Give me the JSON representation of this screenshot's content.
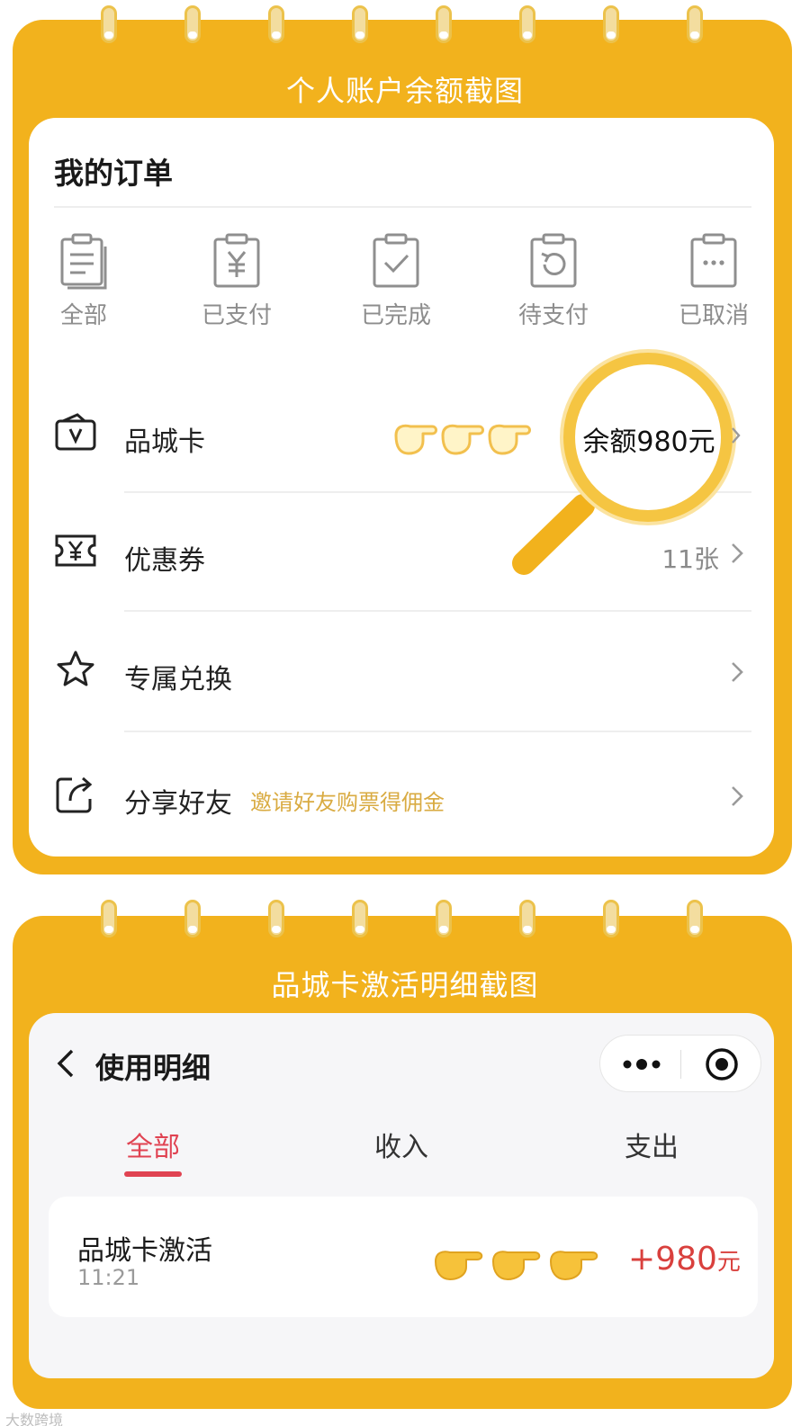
{
  "colors": {
    "frame": "#f2b21d",
    "accent_red": "#e04352",
    "hint_gold": "#d9ab42",
    "amount_red": "#d9403d"
  },
  "section1": {
    "banner_title": "个人账户余额截图",
    "header": "我的订单",
    "order_tabs": [
      {
        "label": "全部",
        "icon": "list-clipboard-icon"
      },
      {
        "label": "已支付",
        "icon": "yen-clipboard-icon"
      },
      {
        "label": "已完成",
        "icon": "check-clipboard-icon"
      },
      {
        "label": "待支付",
        "icon": "refresh-clipboard-icon"
      },
      {
        "label": "已取消",
        "icon": "dots-clipboard-icon"
      }
    ],
    "rows": [
      {
        "label": "品城卡",
        "icon": "v-card-icon",
        "value": ""
      },
      {
        "label": "优惠券",
        "icon": "yen-coupon-icon",
        "value": "11张"
      },
      {
        "label": "专属兑换",
        "icon": "star-icon",
        "value": ""
      },
      {
        "label": "分享好友",
        "icon": "share-icon",
        "sublabel": "邀请好友购票得佣金",
        "value": ""
      }
    ],
    "highlight": {
      "balance_text": "余额980元",
      "pointer_emoji": "👉👉👉"
    }
  },
  "section2": {
    "banner_title": "品城卡激活明细截图",
    "title": "使用明细",
    "tabs": [
      {
        "label": "全部",
        "active": true
      },
      {
        "label": "收入"
      },
      {
        "label": "支出"
      }
    ],
    "record": {
      "title": "品城卡激活",
      "time": "11:21",
      "amount": "+980",
      "unit": "元",
      "pointer_emoji": "👉👉👉"
    }
  },
  "watermark": "大数跨境"
}
